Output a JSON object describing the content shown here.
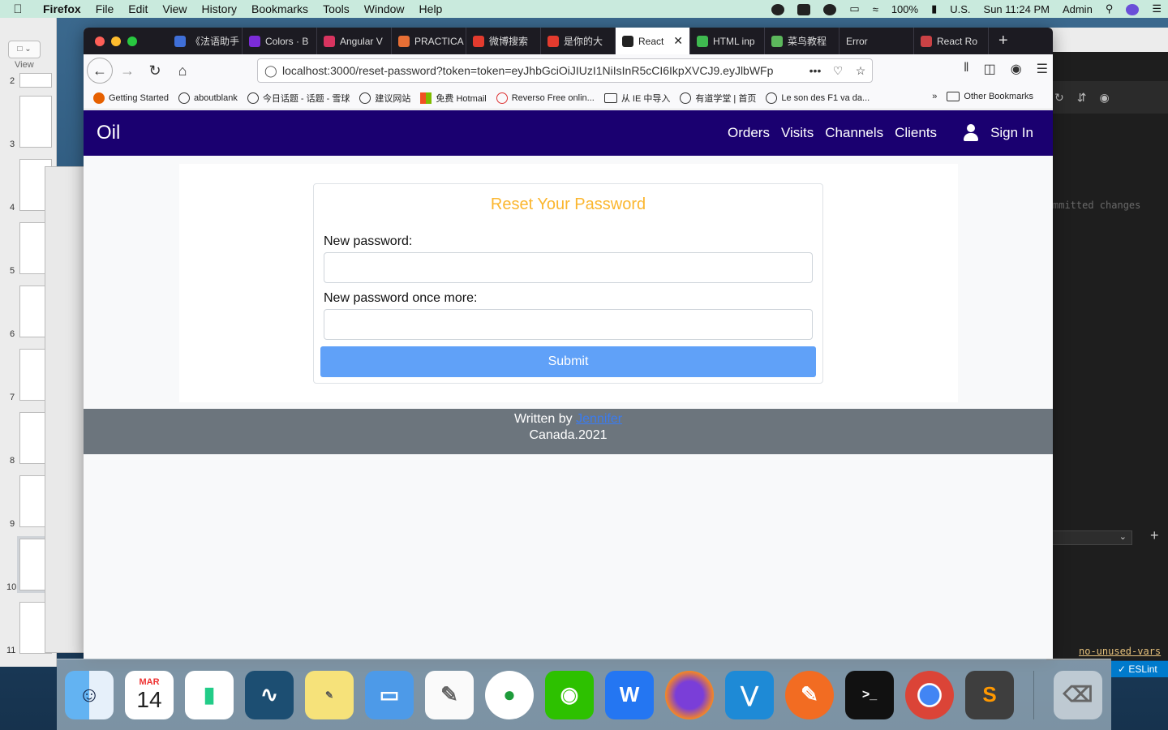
{
  "menubar": {
    "app_name": "Firefox",
    "menus": [
      "File",
      "Edit",
      "View",
      "History",
      "Bookmarks",
      "Tools",
      "Window",
      "Help"
    ],
    "battery": "100%",
    "input_source": "U.S.",
    "clock": "Sun 11:24 PM",
    "user": "Admin"
  },
  "slides": {
    "view_label": "View",
    "numbers": [
      "2",
      "3",
      "4",
      "5",
      "6",
      "7",
      "8",
      "9",
      "10",
      "11"
    ]
  },
  "browser": {
    "tabs": [
      {
        "label": "《法语助手",
        "color": "#3f6fd8"
      },
      {
        "label": "Colors · B",
        "color": "#7b2cd8"
      },
      {
        "label": "Angular V",
        "color": "#d8345f"
      },
      {
        "label": "PRACTICA",
        "color": "#e76f35"
      },
      {
        "label": "微博搜索",
        "color": "#e33b2e"
      },
      {
        "label": "是你的大",
        "color": "#e33b2e"
      },
      {
        "label": "React",
        "color": "#222222",
        "active": true
      },
      {
        "label": "HTML inp",
        "color": "#3fb950"
      },
      {
        "label": "菜鸟教程",
        "color": "#5cb85c"
      },
      {
        "label": "Error",
        "color": "#1c1b22"
      },
      {
        "label": "React Ro",
        "color": "#ca4245"
      }
    ],
    "url": "localhost:3000/reset-password?token=token=eyJhbGciOiJIUzI1NiIsInR5cCI6IkpXVCJ9.eyJlbWFp",
    "bookmarks": [
      {
        "label": "Getting Started"
      },
      {
        "label": "aboutblank"
      },
      {
        "label": "今日话题 - 话题 - 雪球"
      },
      {
        "label": "建议网站"
      },
      {
        "label": "免费 Hotmail"
      },
      {
        "label": "Reverso   Free onlin..."
      },
      {
        "label": "从 IE 中导入"
      },
      {
        "label": "有道学堂 | 首页"
      },
      {
        "label": "Le son des F1 va da..."
      }
    ],
    "other_bookmarks": "Other Bookmarks"
  },
  "app": {
    "brand": "Oil",
    "nav": [
      "Orders",
      "Visits",
      "Channels",
      "Clients"
    ],
    "sign_in": "Sign In",
    "form": {
      "title": "Reset Your Password",
      "label_new": "New password:",
      "label_again": "New password once more:",
      "submit": "Submit"
    },
    "footer": {
      "written_by": "Written by",
      "author": "Jennifer",
      "line2": "Canada.2021"
    }
  },
  "editor": {
    "uncommitted": "mmitted changes",
    "lint_rule": "no-unused-vars",
    "status": "✓ ESLint"
  },
  "dock": {
    "calendar_month": "MAR",
    "calendar_day": "14"
  }
}
